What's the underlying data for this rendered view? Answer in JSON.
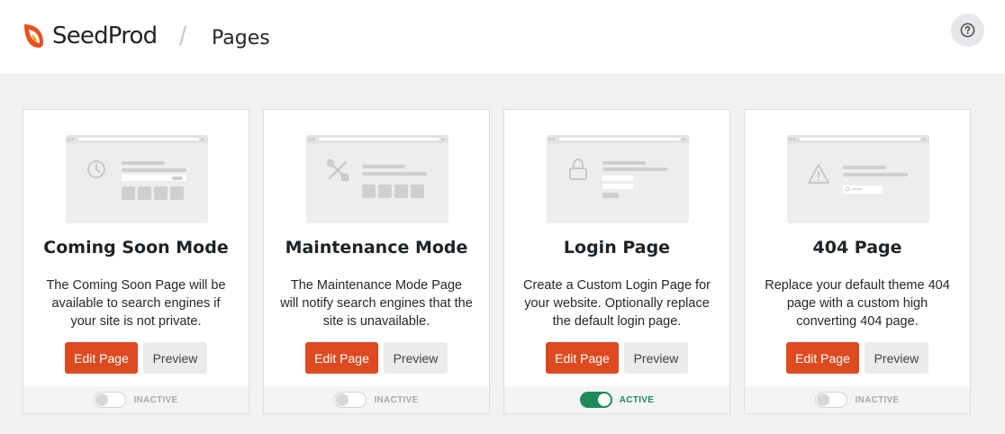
{
  "header": {
    "logo_text": "SeedProd",
    "separator": "/",
    "page_title": "Pages"
  },
  "colors": {
    "accent": "#dd4a1f",
    "active": "#1e8a5b",
    "inactive_text": "#a7aaad"
  },
  "cards": [
    {
      "title": "Coming Soon Mode",
      "description": "The Coming Soon Page will be available to search engines if your site is not private.",
      "edit_label": "Edit Page",
      "preview_label": "Preview",
      "status": "INACTIVE",
      "active": false,
      "icon": "clock-icon"
    },
    {
      "title": "Maintenance Mode",
      "description": "The Maintenance Mode Page will notify search engines that the site is unavailable.",
      "edit_label": "Edit Page",
      "preview_label": "Preview",
      "status": "INACTIVE",
      "active": false,
      "icon": "tools-icon"
    },
    {
      "title": "Login Page",
      "description": "Create a Custom Login Page for your website. Optionally replace the default login page.",
      "edit_label": "Edit Page",
      "preview_label": "Preview",
      "status": "ACTIVE",
      "active": true,
      "icon": "lock-icon"
    },
    {
      "title": "404 Page",
      "description": "Replace your default theme 404 page with a custom high converting 404 page.",
      "edit_label": "Edit Page",
      "preview_label": "Preview",
      "status": "INACTIVE",
      "active": false,
      "icon": "warning-icon"
    }
  ]
}
